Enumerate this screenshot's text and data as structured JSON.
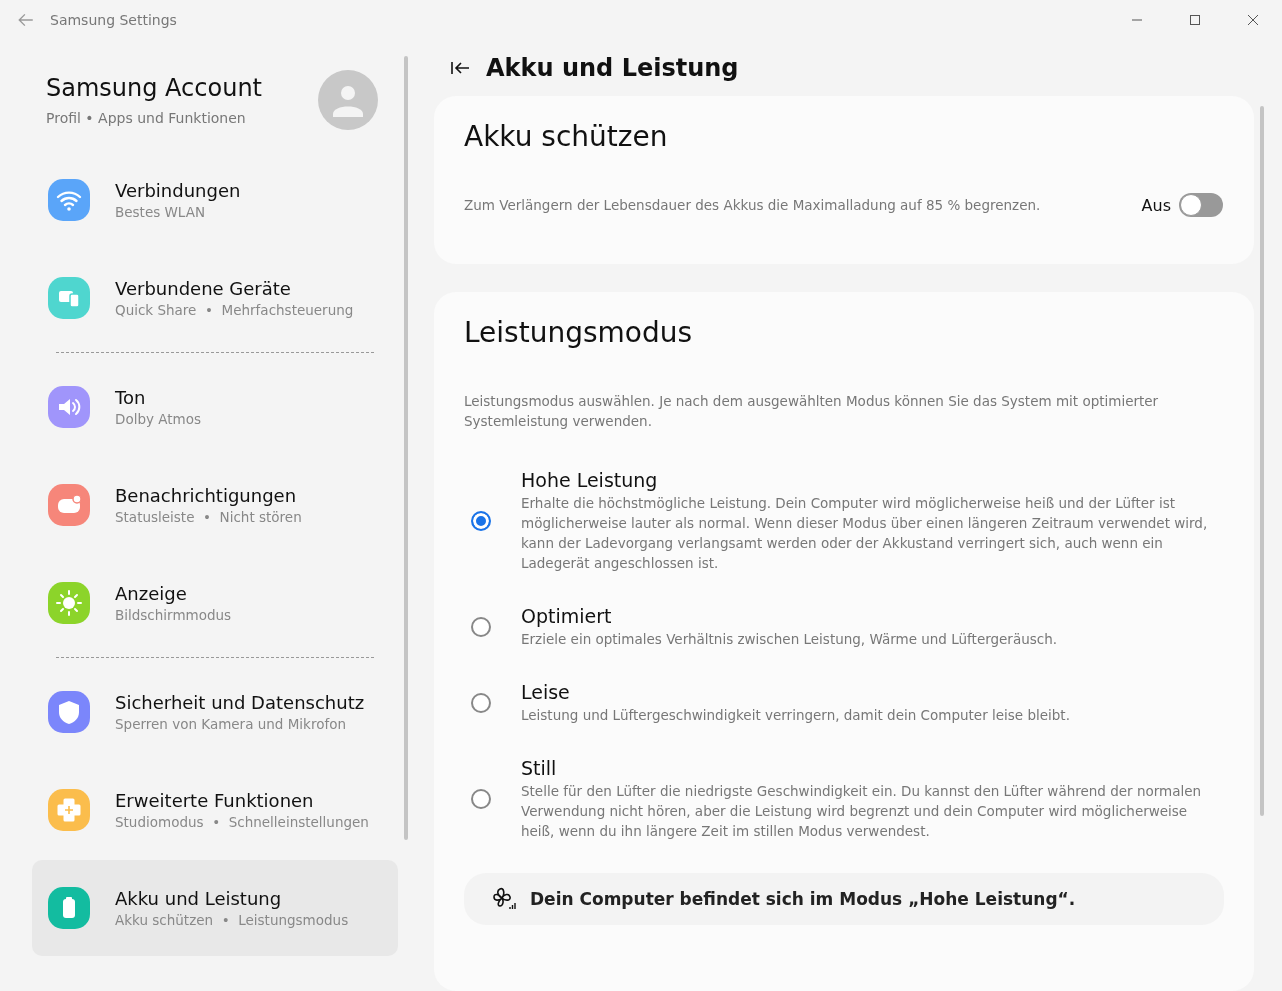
{
  "window": {
    "title": "Samsung Settings"
  },
  "account": {
    "name": "Samsung Account",
    "subtitle": "Profil • Apps und Funktionen"
  },
  "sidebar": {
    "groups": [
      [
        {
          "title": "Verbindungen",
          "subtitle": "Bestes WLAN",
          "color": "#5aa5f9",
          "selected": false
        },
        {
          "title": "Verbundene Geräte",
          "subtitle": "Quick Share  •  Mehrfachsteuerung",
          "color": "#4fd6cf",
          "selected": false
        }
      ],
      [
        {
          "title": "Ton",
          "subtitle": "Dolby Atmos",
          "color": "#a095fb",
          "selected": false
        },
        {
          "title": "Benachrichtigungen",
          "subtitle": "Statusleiste  •  Nicht stören",
          "color": "#f6867a",
          "selected": false
        },
        {
          "title": "Anzeige",
          "subtitle": "Bildschirmmodus",
          "color": "#8cd42a",
          "selected": false
        }
      ],
      [
        {
          "title": "Sicherheit und Datenschutz",
          "subtitle": "Sperren von Kamera und Mikrofon",
          "color": "#7b86fb",
          "selected": false
        },
        {
          "title": "Erweiterte Funktionen",
          "subtitle": "Studiomodus  •  Schnelleinstellungen",
          "color": "#fbbd4c",
          "selected": false
        },
        {
          "title": "Akku und Leistung",
          "subtitle": "Akku schützen  •  Leistungsmodus",
          "color": "#13bca0",
          "selected": true
        }
      ]
    ]
  },
  "page": {
    "title": "Akku und Leistung"
  },
  "protect": {
    "title": "Akku schützen",
    "description": "Zum Verlängern der Lebensdauer des Akkus die Maximalladung auf 85 % begrenzen.",
    "state_label": "Aus",
    "on": false
  },
  "mode": {
    "title": "Leistungsmodus",
    "description": "Leistungsmodus auswählen. Je nach dem ausgewählten Modus können Sie das System mit optimierter Systemleistung verwenden.",
    "options": [
      {
        "title": "Hohe Leistung",
        "description": "Erhalte die höchstmögliche Leistung. Dein Computer wird möglicherweise heiß und der Lüfter ist möglicherweise lauter als normal. Wenn dieser Modus über einen längeren Zeitraum verwendet wird, kann der Ladevorgang verlangsamt werden oder der Akkustand verringert sich, auch wenn ein Ladegerät angeschlossen ist.",
        "selected": true
      },
      {
        "title": "Optimiert",
        "description": "Erziele ein optimales Verhältnis zwischen Leistung, Wärme und Lüftergeräusch.",
        "selected": false
      },
      {
        "title": "Leise",
        "description": "Leistung und Lüftergeschwindigkeit verringern, damit dein Computer leise bleibt.",
        "selected": false
      },
      {
        "title": "Still",
        "description": "Stelle für den Lüfter die niedrigste Geschwindigkeit ein. Du kannst den Lüfter während der normalen Verwendung nicht hören, aber die Leistung wird begrenzt und dein Computer wird möglicherweise heiß, wenn du ihn längere Zeit im stillen Modus verwendest.",
        "selected": false
      }
    ],
    "status": "Dein Computer befindet sich im Modus „Hohe Leistung“."
  }
}
